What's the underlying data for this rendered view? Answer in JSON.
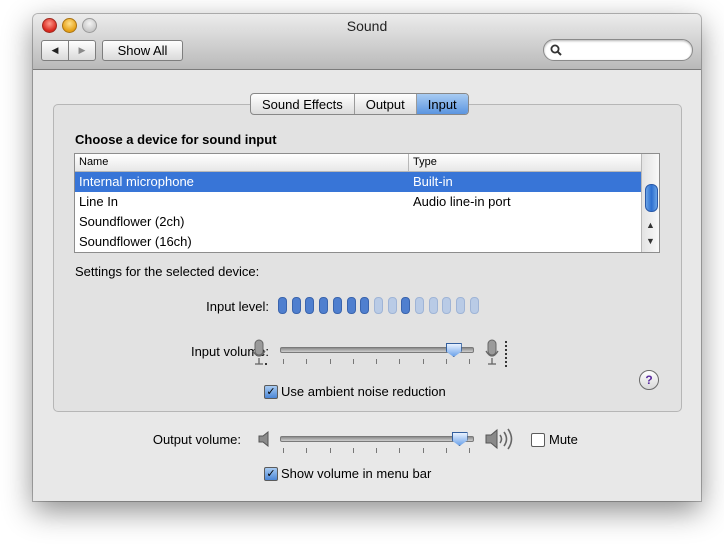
{
  "window": {
    "title": "Sound"
  },
  "toolbar": {
    "back_glyph": "◀",
    "forward_glyph": "▶",
    "show_all_label": "Show All",
    "search": {
      "placeholder": "",
      "value": ""
    }
  },
  "tabs": [
    {
      "label": "Sound Effects",
      "active": false
    },
    {
      "label": "Output",
      "active": false
    },
    {
      "label": "Input",
      "active": true
    }
  ],
  "input_panel": {
    "section_title": "Choose a device for sound input",
    "table": {
      "columns": [
        "Name",
        "Type"
      ],
      "rows": [
        {
          "name": "Internal microphone",
          "type": "Built-in",
          "selected": true
        },
        {
          "name": "Line In",
          "type": "Audio line-in port",
          "selected": false
        },
        {
          "name": "Soundflower (2ch)",
          "type": "",
          "selected": false
        },
        {
          "name": "Soundflower (16ch)",
          "type": "",
          "selected": false
        }
      ]
    },
    "settings_label": "Settings for the selected device:",
    "input_level_label": "Input level:",
    "input_level": {
      "segments": 15,
      "lit": 7
    },
    "input_volume_label": "Input volume:",
    "input_volume": 0.9,
    "noise_reduction": {
      "label": "Use ambient noise reduction",
      "checked": true
    },
    "help_label": "?"
  },
  "output": {
    "volume_label": "Output volume:",
    "volume": 0.93,
    "mute": {
      "label": "Mute",
      "checked": false
    },
    "menu_bar": {
      "label": "Show volume in menu bar",
      "checked": true
    }
  },
  "colors": {
    "selection": "#3875d7",
    "level_lit": "#4f7fcf",
    "level_dim": "#b9cbe6"
  }
}
